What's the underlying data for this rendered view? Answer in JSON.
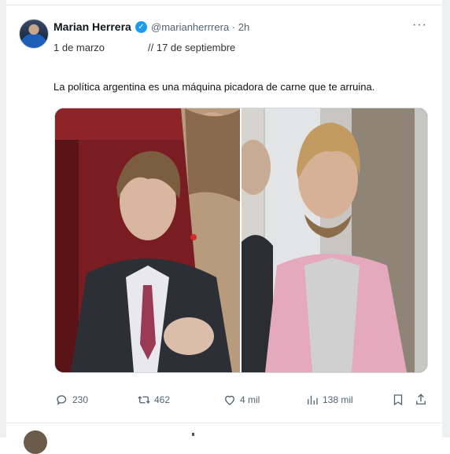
{
  "tweet": {
    "author_name": "Marian Herrera",
    "handle_time": "@marianherrrera · 2h",
    "more_label": "···",
    "date_left": "1 de marzo",
    "date_right": "// 17 de septiembre",
    "text": "La política argentina es una máquina picadora de carne que te arruina.",
    "stats": {
      "replies": "230",
      "retweets": "462",
      "likes": "4 mil",
      "views": "138 mil"
    }
  },
  "colors": {
    "verified": "#1d9bf0",
    "text": "#0f1419",
    "muted": "#536471"
  },
  "icons": [
    "avatar",
    "verified-badge-icon",
    "more-icon",
    "reply-icon",
    "retweet-icon",
    "like-icon",
    "views-icon",
    "bookmark-icon",
    "share-icon"
  ]
}
